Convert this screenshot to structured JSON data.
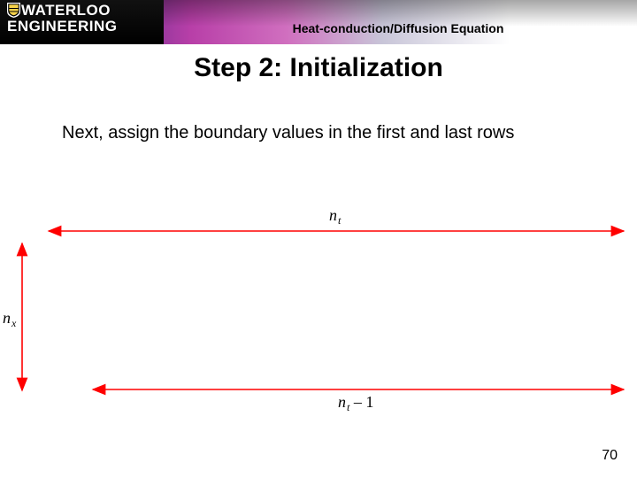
{
  "banner": {
    "logo_line1": "WATERLOO",
    "logo_line2": "ENGINEERING",
    "topic": "Heat-conduction/Diffusion Equation"
  },
  "heading": "Step 2:  Initialization",
  "body": "Next, assign the boundary values in the first and last rows",
  "labels": {
    "nt_n": "n",
    "nt_sub": "t",
    "nx_n": "n",
    "nx_sub": "x",
    "ntm1_n": "n",
    "ntm1_sub": "t",
    "ntm1_tail": " – 1"
  },
  "page_number": "70",
  "colors": {
    "arrow": "#ff0000"
  }
}
